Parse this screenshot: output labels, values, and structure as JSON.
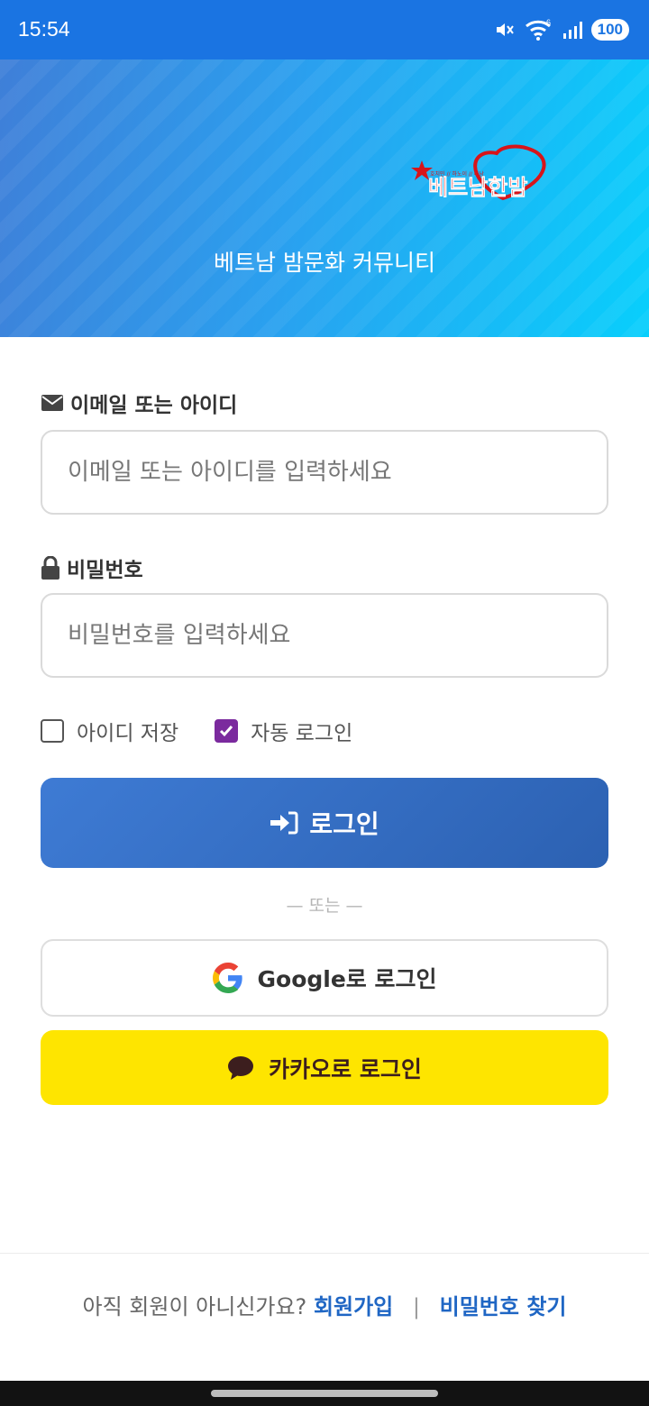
{
  "status_bar": {
    "time": "15:54",
    "battery": "100",
    "wifi_badge": "6"
  },
  "hero": {
    "logo_text": "베트남한밤",
    "logo_small_text": "호치민 // 하노이 // 다낭",
    "subtitle": "베트남 밤문화 커뮤니티"
  },
  "form": {
    "email_label": "이메일 또는 아이디",
    "email_placeholder": "이메일 또는 아이디를 입력하세요",
    "email_value": "",
    "password_label": "비밀번호",
    "password_placeholder": "비밀번호를 입력하세요",
    "password_value": "",
    "save_id_label": "아이디 저장",
    "save_id_checked": false,
    "auto_login_label": "자동 로그인",
    "auto_login_checked": true
  },
  "buttons": {
    "login": "로그인",
    "or_divider": "— 또는 —",
    "google": "Google로 로그인",
    "kakao": "카카오로 로그인"
  },
  "footer": {
    "question": "아직 회원이 아니신가요?",
    "signup": "회원가입",
    "separator": "|",
    "find_password": "비밀번호 찾기"
  },
  "colors": {
    "status_bar": "#1a74e2",
    "primary": "#2c61b2",
    "checkbox_checked": "#7b2a9e",
    "kakao": "#fee500",
    "link": "#1f66c4",
    "logo_red": "#d7141a"
  }
}
